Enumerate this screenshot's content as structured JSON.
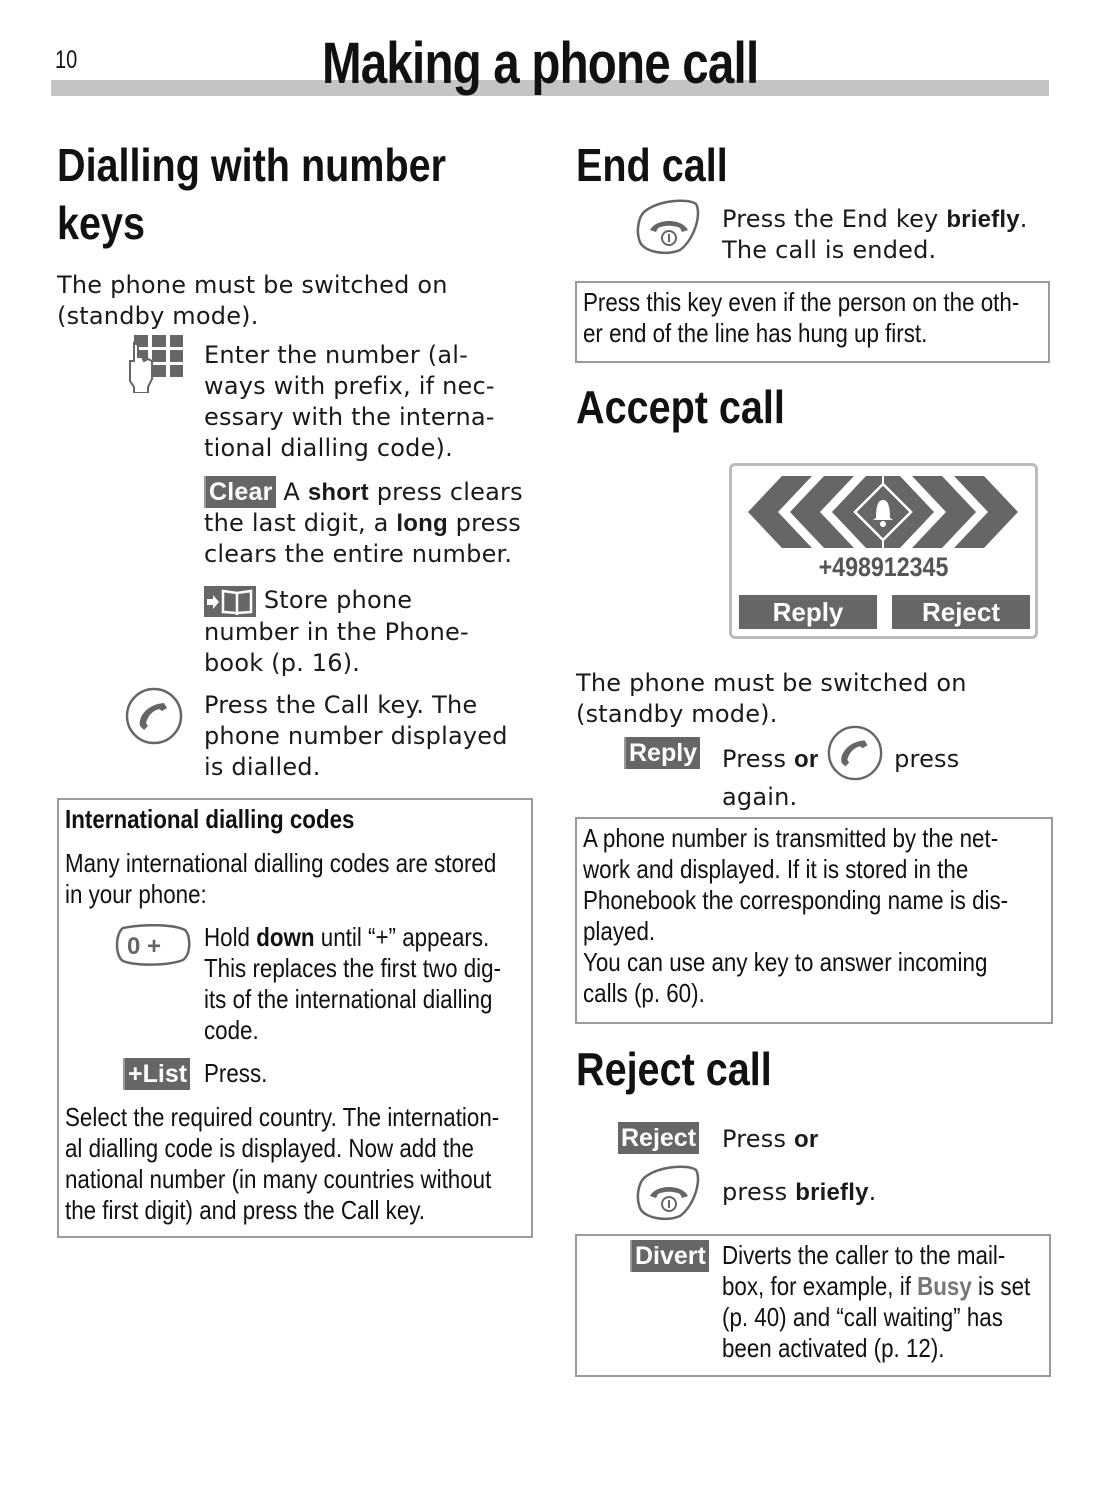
{
  "header": {
    "page_number": "10",
    "title": "Making a phone call"
  },
  "left": {
    "heading_line1": "Dialling with number",
    "heading_line2": "keys",
    "intro_line1": "The phone must be switched on",
    "intro_line2": "(standby mode).",
    "enter_number": [
      "Enter the number (al-",
      "ways with prefix, if nec-",
      "essary with the interna-",
      "tional dialling code)."
    ],
    "clear_key": "Clear",
    "clear_text_a": "A",
    "clear_bold_short": "short",
    "clear_text_b": "press clears",
    "clear_line2_a": "the last digit, a",
    "clear_bold_long": "long",
    "clear_line2_b": "press",
    "clear_line3": "clears the entire number.",
    "store_line1": "Store phone",
    "store_line2": "number in the Phone-",
    "store_line3": "book (p. 16).",
    "call_lines": [
      "Press the Call key. The",
      "phone number displayed",
      "is dialled."
    ],
    "intl_box": {
      "title": "International dialling codes",
      "intro": [
        "Many international dialling codes are stored",
        "in your phone:"
      ],
      "zero_key": "0 +",
      "hold_a": "Hold",
      "hold_bold": "down",
      "hold_b": "until “+” appears.",
      "hold_lines": [
        "This replaces the first two dig-",
        "its of the international dialling",
        "code."
      ],
      "list_key": "+List",
      "list_text": "Press.",
      "select_lines": [
        "Select the required country. The internation-",
        "al dialling code is displayed. Now add the",
        "national number (in many countries without",
        "the first digit) and press the Call key."
      ]
    }
  },
  "right": {
    "end_call": {
      "heading": "End call",
      "line1_a": "Press the End key",
      "line1_bold": "briefly",
      "line1_b": ".",
      "line2": "The call is ended.",
      "note": [
        "Press this key even if the person on the oth-",
        "er end of the line has hung up first."
      ]
    },
    "accept_call": {
      "heading": "Accept call",
      "display": {
        "number": "+498912345",
        "left_softkey": "Reply",
        "right_softkey": "Reject"
      },
      "intro_line1": "The phone must be switched on",
      "intro_line2": "(standby mode).",
      "reply_key": "Reply",
      "press_a": "Press",
      "press_or": "or",
      "press_b": "press",
      "press_line2": "again.",
      "note": [
        "A phone number is transmitted by the net-",
        "work and displayed. If it is stored in the",
        "Phonebook the corresponding name is dis-",
        "played.",
        "You can use any key to answer incoming",
        "calls (p. 60)."
      ]
    },
    "reject_call": {
      "heading": "Reject call",
      "reject_key": "Reject",
      "press_a": "Press",
      "press_or": "or",
      "press2_a": "press",
      "press2_bold": "briefly",
      "press2_b": ".",
      "divert_key": "Divert",
      "divert_line1": "Diverts the caller to the mail-",
      "divert_line2_a": "box, for example, if",
      "divert_busy": "Busy",
      "divert_line2_b": "is set",
      "divert_line3": "(p. 40) and “call waiting” has",
      "divert_line4": "been activated (p. 12)."
    }
  },
  "colors": {
    "softkey_bg": "#666666",
    "header_bar": "#c4c4c4",
    "box_border": "#9a9a9a",
    "busy_text": "#777777"
  }
}
